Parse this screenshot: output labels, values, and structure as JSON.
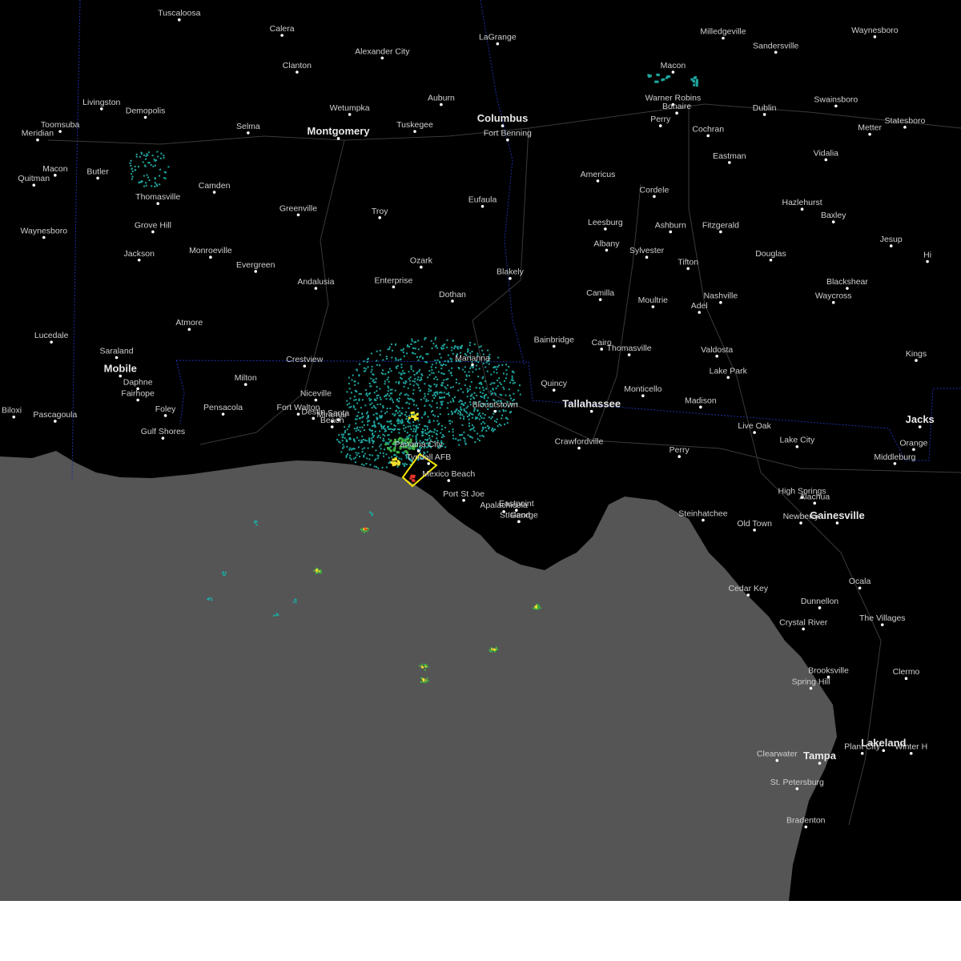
{
  "colors": {
    "land": "#000000",
    "water": "#555555",
    "roads": "#3a3a3a",
    "state_border": "#1f2fa8",
    "radar_light": "#1fa7a0",
    "radar_mid": "#3cb043",
    "radar_heavy": "#f2e22a",
    "radar_core": "#e8382c",
    "warning_polygon": "#f4e600"
  },
  "cities": [
    {
      "name": "Tuscaloosa",
      "lat": 33.21,
      "lon": -87.57,
      "major": false
    },
    {
      "name": "Macon",
      "lat": 32.11,
      "lon": -88.56,
      "major": false
    },
    {
      "name": "Calera",
      "lat": 33.1,
      "lon": -86.75,
      "major": false
    },
    {
      "name": "LaGrange",
      "lat": 33.04,
      "lon": -85.03,
      "major": false
    },
    {
      "name": "Milledgeville",
      "lat": 33.08,
      "lon": -83.23,
      "major": false
    },
    {
      "name": "Waynesboro",
      "lat": 33.09,
      "lon": -82.02,
      "major": false
    },
    {
      "name": "Alexander City",
      "lat": 32.94,
      "lon": -85.95,
      "major": false
    },
    {
      "name": "Sandersville",
      "lat": 32.98,
      "lon": -82.81,
      "major": false
    },
    {
      "name": "Clanton",
      "lat": 32.84,
      "lon": -86.63,
      "major": false
    },
    {
      "name": "Macon",
      "lat": 32.84,
      "lon": -83.63,
      "major": false
    },
    {
      "name": "Livingston",
      "lat": 32.58,
      "lon": -88.19,
      "major": false
    },
    {
      "name": "Wetumpka",
      "lat": 32.54,
      "lon": -86.21,
      "major": false
    },
    {
      "name": "Auburn",
      "lat": 32.61,
      "lon": -85.48,
      "major": false
    },
    {
      "name": "Warner Robins",
      "lat": 32.61,
      "lon": -83.63,
      "major": false
    },
    {
      "name": "Swainsboro",
      "lat": 32.6,
      "lon": -82.33,
      "major": false
    },
    {
      "name": "Demopolis",
      "lat": 32.52,
      "lon": -87.84,
      "major": false
    },
    {
      "name": "Columbus",
      "lat": 32.46,
      "lon": -84.99,
      "major": true
    },
    {
      "name": "Tuskegee",
      "lat": 32.42,
      "lon": -85.69,
      "major": false
    },
    {
      "name": "Bonaire",
      "lat": 32.55,
      "lon": -83.6,
      "major": false
    },
    {
      "name": "Dublin",
      "lat": 32.54,
      "lon": -82.9,
      "major": false
    },
    {
      "name": "Statesboro",
      "lat": 32.45,
      "lon": -81.78,
      "major": false
    },
    {
      "name": "Perry",
      "lat": 32.46,
      "lon": -83.73,
      "major": false
    },
    {
      "name": "Selma",
      "lat": 32.41,
      "lon": -87.02,
      "major": false
    },
    {
      "name": "Montgomery",
      "lat": 32.37,
      "lon": -86.3,
      "major": true
    },
    {
      "name": "Meridian",
      "lat": 32.36,
      "lon": -88.7,
      "major": false
    },
    {
      "name": "Toomsuba",
      "lat": 32.42,
      "lon": -88.52,
      "major": false
    },
    {
      "name": "Cochran",
      "lat": 32.39,
      "lon": -83.35,
      "major": false
    },
    {
      "name": "Metter",
      "lat": 32.4,
      "lon": -82.06,
      "major": false
    },
    {
      "name": "Fort Benning",
      "lat": 32.36,
      "lon": -84.95,
      "major": false
    },
    {
      "name": "Eastman",
      "lat": 32.2,
      "lon": -83.18,
      "major": false
    },
    {
      "name": "Vidalia",
      "lat": 32.22,
      "lon": -82.41,
      "major": false
    },
    {
      "name": "Butler",
      "lat": 32.09,
      "lon": -88.22,
      "major": false
    },
    {
      "name": "Americus",
      "lat": 32.07,
      "lon": -84.23,
      "major": false
    },
    {
      "name": "Quitman",
      "lat": 32.04,
      "lon": -88.73,
      "major": false
    },
    {
      "name": "Camden",
      "lat": 31.99,
      "lon": -87.29,
      "major": false
    },
    {
      "name": "Cordele",
      "lat": 31.96,
      "lon": -83.78,
      "major": false
    },
    {
      "name": "Thomasville",
      "lat": 31.91,
      "lon": -87.74,
      "major": false
    },
    {
      "name": "Eufaula",
      "lat": 31.89,
      "lon": -85.15,
      "major": false
    },
    {
      "name": "Hazlehurst",
      "lat": 31.87,
      "lon": -82.6,
      "major": false
    },
    {
      "name": "Greenville",
      "lat": 31.83,
      "lon": -86.62,
      "major": false
    },
    {
      "name": "Troy",
      "lat": 31.81,
      "lon": -85.97,
      "major": false
    },
    {
      "name": "Baxley",
      "lat": 31.78,
      "lon": -82.35,
      "major": false
    },
    {
      "name": "Leesburg",
      "lat": 31.73,
      "lon": -84.17,
      "major": false
    },
    {
      "name": "Fitzgerald",
      "lat": 31.71,
      "lon": -83.25,
      "major": false
    },
    {
      "name": "Grove Hill",
      "lat": 31.71,
      "lon": -87.78,
      "major": false
    },
    {
      "name": "Waynesboro",
      "lat": 31.67,
      "lon": -88.65,
      "major": false
    },
    {
      "name": "Ashburn",
      "lat": 31.71,
      "lon": -83.65,
      "major": false
    },
    {
      "name": "Albany",
      "lat": 31.58,
      "lon": -84.16,
      "major": false
    },
    {
      "name": "Jesup",
      "lat": 31.61,
      "lon": -81.89,
      "major": false
    },
    {
      "name": "Monroeville",
      "lat": 31.53,
      "lon": -87.32,
      "major": false
    },
    {
      "name": "Sylvester",
      "lat": 31.53,
      "lon": -83.84,
      "major": false
    },
    {
      "name": "Jackson",
      "lat": 31.51,
      "lon": -87.89,
      "major": false
    },
    {
      "name": "Douglas",
      "lat": 31.51,
      "lon": -82.85,
      "major": false
    },
    {
      "name": "Ozark",
      "lat": 31.46,
      "lon": -85.64,
      "major": false
    },
    {
      "name": "Tifton",
      "lat": 31.45,
      "lon": -83.51,
      "major": false
    },
    {
      "name": "Evergreen",
      "lat": 31.43,
      "lon": -86.96,
      "major": false
    },
    {
      "name": "Blakely",
      "lat": 31.38,
      "lon": -84.93,
      "major": false
    },
    {
      "name": "Andalusia",
      "lat": 31.31,
      "lon": -86.48,
      "major": false
    },
    {
      "name": "Enterprise",
      "lat": 31.32,
      "lon": -85.86,
      "major": false
    },
    {
      "name": "Camilla",
      "lat": 31.23,
      "lon": -84.21,
      "major": false
    },
    {
      "name": "Nashville",
      "lat": 31.21,
      "lon": -83.25,
      "major": false
    },
    {
      "name": "Blackshear",
      "lat": 31.31,
      "lon": -82.24,
      "major": false
    },
    {
      "name": "Dothan",
      "lat": 31.22,
      "lon": -85.39,
      "major": false
    },
    {
      "name": "Moultrie",
      "lat": 31.18,
      "lon": -83.79,
      "major": false
    },
    {
      "name": "Adel",
      "lat": 31.14,
      "lon": -83.42,
      "major": false
    },
    {
      "name": "Waycross",
      "lat": 31.21,
      "lon": -82.35,
      "major": false
    },
    {
      "name": "Atmore",
      "lat": 31.02,
      "lon": -87.49,
      "major": false
    },
    {
      "name": "Lucedale",
      "lat": 30.93,
      "lon": -88.59,
      "major": false
    },
    {
      "name": "Bainbridge",
      "lat": 30.9,
      "lon": -84.58,
      "major": false
    },
    {
      "name": "Saraland",
      "lat": 30.82,
      "lon": -88.07,
      "major": false
    },
    {
      "name": "Cairo",
      "lat": 30.88,
      "lon": -84.2,
      "major": false
    },
    {
      "name": "Thomasville",
      "lat": 30.84,
      "lon": -83.98,
      "major": false
    },
    {
      "name": "Valdosta",
      "lat": 30.83,
      "lon": -83.28,
      "major": false
    },
    {
      "name": "Marianna",
      "lat": 30.77,
      "lon": -85.23,
      "major": false
    },
    {
      "name": "Crestview",
      "lat": 30.76,
      "lon": -86.57,
      "major": false
    },
    {
      "name": "Mobile",
      "lat": 30.69,
      "lon": -88.04,
      "major": true
    },
    {
      "name": "Kings",
      "lat": 30.8,
      "lon": -81.69,
      "major": false
    },
    {
      "name": "Lake Park",
      "lat": 30.68,
      "lon": -83.19,
      "major": false
    },
    {
      "name": "Milton",
      "lat": 30.63,
      "lon": -87.04,
      "major": false
    },
    {
      "name": "Daphne",
      "lat": 30.6,
      "lon": -87.9,
      "major": false
    },
    {
      "name": "Quincy",
      "lat": 30.59,
      "lon": -84.58,
      "major": false
    },
    {
      "name": "Monticello",
      "lat": 30.55,
      "lon": -83.87,
      "major": false
    },
    {
      "name": "Niceville",
      "lat": 30.52,
      "lon": -86.48,
      "major": false
    },
    {
      "name": "Fairhope",
      "lat": 30.52,
      "lon": -87.9,
      "major": false
    },
    {
      "name": "Madison",
      "lat": 30.47,
      "lon": -83.41,
      "major": false
    },
    {
      "name": "Blountstown",
      "lat": 30.44,
      "lon": -85.05,
      "major": false
    },
    {
      "name": "Tallahassee",
      "lat": 30.44,
      "lon": -84.28,
      "major": true
    },
    {
      "name": "Pensacola",
      "lat": 30.42,
      "lon": -87.22,
      "major": false
    },
    {
      "name": "Foley",
      "lat": 30.41,
      "lon": -87.68,
      "major": false
    },
    {
      "name": "Biloxi",
      "lat": 30.4,
      "lon": -88.89,
      "major": false
    },
    {
      "name": "Pascagoula",
      "lat": 30.37,
      "lon": -88.56,
      "major": false
    },
    {
      "name": "Jacks",
      "lat": 30.33,
      "lon": -81.66,
      "major": true
    },
    {
      "name": "Live Oak",
      "lat": 30.29,
      "lon": -82.98,
      "major": false
    },
    {
      "name": "Gulf Shores",
      "lat": 30.25,
      "lon": -87.7,
      "major": false
    },
    {
      "name": "Crawfordville",
      "lat": 30.18,
      "lon": -84.38,
      "major": false
    },
    {
      "name": "Lake City",
      "lat": 30.19,
      "lon": -82.64,
      "major": false
    },
    {
      "name": "Orange",
      "lat": 30.17,
      "lon": -81.71,
      "major": false
    },
    {
      "name": "Panama City",
      "lat": 30.16,
      "lon": -85.66,
      "major": false
    },
    {
      "name": "Perry",
      "lat": 30.12,
      "lon": -83.58,
      "major": false
    },
    {
      "name": "Middleburg",
      "lat": 30.07,
      "lon": -81.86,
      "major": false
    },
    {
      "name": "Tyndall AFB",
      "lat": 30.07,
      "lon": -85.58,
      "major": false
    },
    {
      "name": "Mexico Beach",
      "lat": 29.95,
      "lon": -85.42,
      "major": false
    },
    {
      "name": "Port St Joe",
      "lat": 29.81,
      "lon": -85.3,
      "major": false
    },
    {
      "name": "High Springs",
      "lat": 29.83,
      "lon": -82.6,
      "major": false
    },
    {
      "name": "Alachua",
      "lat": 29.79,
      "lon": -82.5,
      "major": false
    },
    {
      "name": "Apalachicola",
      "lat": 29.73,
      "lon": -84.98,
      "major": false
    },
    {
      "name": "Eastpoint",
      "lat": 29.74,
      "lon": -84.88,
      "major": false
    },
    {
      "name": "Gainesville",
      "lat": 29.65,
      "lon": -82.32,
      "major": true
    },
    {
      "name": "Steinhatchee",
      "lat": 29.67,
      "lon": -83.39,
      "major": false
    },
    {
      "name": "Old Town",
      "lat": 29.6,
      "lon": -82.98,
      "major": false
    },
    {
      "name": "Newberry",
      "lat": 29.65,
      "lon": -82.61,
      "major": false
    },
    {
      "name": "St George",
      "lat": 29.66,
      "lon": -84.86,
      "major": false
    },
    {
      "name": "Island",
      "lat": 29.66,
      "lon": -84.86,
      "major": false
    },
    {
      "name": "Ocala",
      "lat": 29.19,
      "lon": -82.14,
      "major": false
    },
    {
      "name": "Cedar Key",
      "lat": 29.14,
      "lon": -83.03,
      "major": false
    },
    {
      "name": "Dunnellon",
      "lat": 29.05,
      "lon": -82.46,
      "major": false
    },
    {
      "name": "The Villages",
      "lat": 28.93,
      "lon": -81.96,
      "major": false
    },
    {
      "name": "Crystal River",
      "lat": 28.9,
      "lon": -82.59,
      "major": false
    },
    {
      "name": "Brooksville",
      "lat": 28.56,
      "lon": -82.39,
      "major": false
    },
    {
      "name": "Clermo",
      "lat": 28.55,
      "lon": -81.77,
      "major": false
    },
    {
      "name": "Spring Hill",
      "lat": 28.48,
      "lon": -82.53,
      "major": false
    },
    {
      "name": "Lakeland",
      "lat": 28.04,
      "lon": -81.95,
      "major": true
    },
    {
      "name": "Tampa",
      "lat": 27.95,
      "lon": -82.46,
      "major": true
    },
    {
      "name": "Plant City",
      "lat": 28.02,
      "lon": -82.12,
      "major": false
    },
    {
      "name": "Winter H",
      "lat": 28.02,
      "lon": -81.73,
      "major": false
    },
    {
      "name": "Clearwater",
      "lat": 27.97,
      "lon": -82.8,
      "major": false
    },
    {
      "name": "St. Petersburg",
      "lat": 27.77,
      "lon": -82.64,
      "major": false
    },
    {
      "name": "Bradenton",
      "lat": 27.5,
      "lon": -82.57,
      "major": false
    },
    {
      "name": "Miramar",
      "lat": 30.37,
      "lon": -86.35,
      "major": false
    },
    {
      "name": "Beach",
      "lat": 30.33,
      "lon": -86.35,
      "major": false
    },
    {
      "name": "Fort Walton",
      "lat": 30.42,
      "lon": -86.62,
      "major": false
    },
    {
      "name": "Destin",
      "lat": 30.39,
      "lon": -86.5,
      "major": false
    },
    {
      "name": "Santa",
      "lat": 30.38,
      "lon": -86.3,
      "major": false
    },
    {
      "name": "Hi",
      "lat": 31.5,
      "lon": -81.6,
      "major": false
    }
  ]
}
